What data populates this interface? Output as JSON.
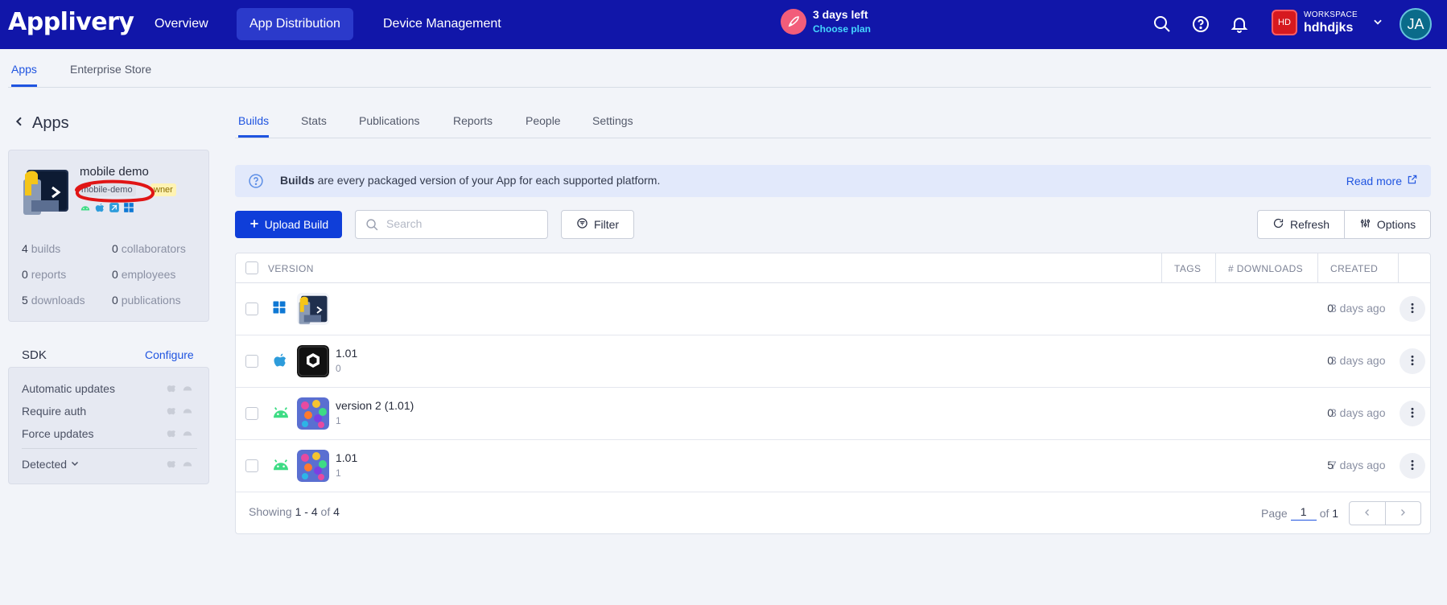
{
  "brand": {
    "logo": "Applivery"
  },
  "topnav": {
    "items": [
      {
        "label": "Overview"
      },
      {
        "label": "App Distribution"
      },
      {
        "label": "Device Management"
      }
    ],
    "trial": {
      "title": "3 days left",
      "link": "Choose plan"
    },
    "workspace": {
      "badge": "HD",
      "label": "WORKSPACE",
      "name": "hdhdjks"
    },
    "avatar": "JA"
  },
  "subtabs": [
    {
      "label": "Apps"
    },
    {
      "label": "Enterprise Store"
    }
  ],
  "sidebar": {
    "back_label": "Apps",
    "app": {
      "name": "mobile demo",
      "slug": "mobile-demo",
      "role": "Owner",
      "role_visible": "wner"
    },
    "stats": [
      {
        "value": "4",
        "label": "builds"
      },
      {
        "value": "0",
        "label": "collaborators"
      },
      {
        "value": "0",
        "label": "reports"
      },
      {
        "value": "0",
        "label": "employees"
      },
      {
        "value": "5",
        "label": "downloads"
      },
      {
        "value": "0",
        "label": "publications"
      }
    ],
    "sdk": {
      "title": "SDK",
      "configure": "Configure",
      "items": [
        {
          "label": "Automatic updates"
        },
        {
          "label": "Require auth"
        },
        {
          "label": "Force updates"
        }
      ],
      "detected": "Detected"
    }
  },
  "main": {
    "tabs": [
      {
        "label": "Builds"
      },
      {
        "label": "Stats"
      },
      {
        "label": "Publications"
      },
      {
        "label": "Reports"
      },
      {
        "label": "People"
      },
      {
        "label": "Settings"
      }
    ],
    "info": {
      "bold": "Builds",
      "text": " are every packaged version of your App for each supported platform.",
      "read_more": "Read more"
    },
    "toolbar": {
      "upload": "Upload Build",
      "search_placeholder": "Search",
      "filter": "Filter",
      "refresh": "Refresh",
      "options": "Options"
    },
    "table": {
      "headers": {
        "version": "VERSION",
        "tags": "TAGS",
        "downloads": "# DOWNLOADS",
        "created": "CREATED"
      },
      "rows": [
        {
          "platform": "windows",
          "version": "",
          "code": "",
          "downloads": "0",
          "created": "3 days ago"
        },
        {
          "platform": "ios",
          "version": "1.01",
          "code": "0",
          "downloads": "0",
          "created": "3 days ago"
        },
        {
          "platform": "android",
          "version": "version 2 (1.01)",
          "code": "1",
          "downloads": "0",
          "created": "3 days ago"
        },
        {
          "platform": "android",
          "version": "1.01",
          "code": "1",
          "downloads": "5",
          "created": "7 days ago"
        }
      ]
    },
    "footer": {
      "showing": "Showing",
      "from": "1",
      "sep": "-",
      "to": "4",
      "of": "of",
      "total": "4",
      "page_label": "Page",
      "page": "1",
      "of_label": "of",
      "pages": "1"
    }
  },
  "colors": {
    "topbar": "#1116a9",
    "accent": "#1f54e0",
    "android": "#3ddc84",
    "apple": "#2d9cdb",
    "windows": "#0f78d4"
  }
}
